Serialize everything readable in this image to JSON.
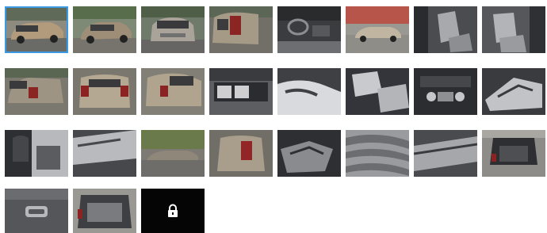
{
  "gallery": {
    "selected_index": 0,
    "accent_color": "#3b9ae1",
    "locked_background": "#050505",
    "thumbnails": [
      {
        "row": 1,
        "subject": "exterior-front-three-quarter"
      },
      {
        "row": 1,
        "subject": "exterior-front-three-quarter"
      },
      {
        "row": 1,
        "subject": "exterior-front"
      },
      {
        "row": 1,
        "subject": "exterior-rear-three-quarter"
      },
      {
        "row": 1,
        "subject": "interior-dashboard"
      },
      {
        "row": 1,
        "subject": "exterior-side-street"
      },
      {
        "row": 1,
        "subject": "interior-front-seats"
      },
      {
        "row": 1,
        "subject": "interior-rear-seats"
      },
      {
        "row": 2,
        "subject": "exterior-rear-three-quarter"
      },
      {
        "row": 2,
        "subject": "exterior-rear"
      },
      {
        "row": 2,
        "subject": "exterior-rear-three-quarter"
      },
      {
        "row": 2,
        "subject": "interior-rear-bench"
      },
      {
        "row": 2,
        "subject": "interior-seat-detail"
      },
      {
        "row": 2,
        "subject": "interior-seat-detail"
      },
      {
        "row": 2,
        "subject": "interior-center-console"
      },
      {
        "row": 2,
        "subject": "interior-door-panel"
      },
      {
        "row": 3,
        "subject": "interior-headrest"
      },
      {
        "row": 3,
        "subject": "interior-floor"
      },
      {
        "row": 3,
        "subject": "exterior-side"
      },
      {
        "row": 3,
        "subject": "exterior-rear-light"
      },
      {
        "row": 3,
        "subject": "interior-floor-mat"
      },
      {
        "row": 3,
        "subject": "tire-tread"
      },
      {
        "row": 3,
        "subject": "cargo-cover"
      },
      {
        "row": 3,
        "subject": "open-trunk"
      },
      {
        "row": 4,
        "subject": "trunk-panel"
      },
      {
        "row": 4,
        "subject": "trunk-cargo-area"
      },
      {
        "row": 4,
        "subject": "locked",
        "icon": "lock-icon"
      }
    ]
  }
}
